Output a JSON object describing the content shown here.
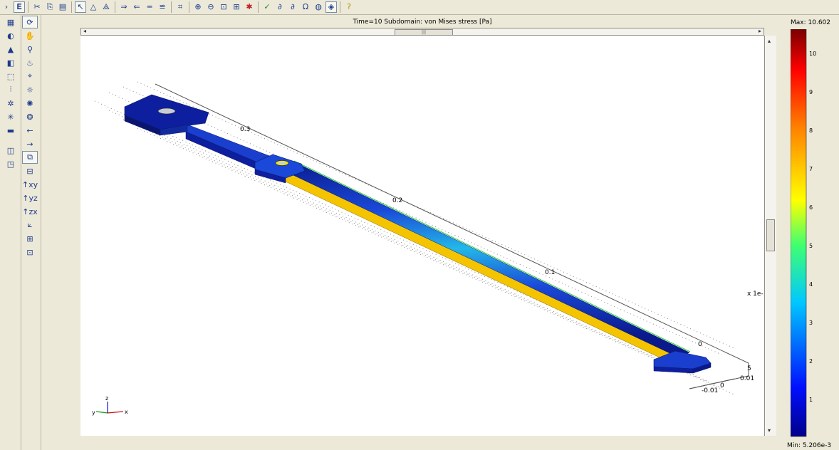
{
  "toolbar": {
    "icons": [
      "scissors-icon",
      "copy-icon",
      "paste-icon",
      "pointer-icon",
      "triangle-icon",
      "triangles-icon",
      "arrow-right-icon",
      "arrow-left-icon",
      "equals-icon",
      "stack-icon",
      "mesh-icon",
      "zoom-in-icon",
      "zoom-out-icon",
      "zoom-box-icon",
      "zoom-extents-icon",
      "plot-icon",
      "check-icon",
      "formula-icon",
      "formula2-icon",
      "omega-icon",
      "globe-icon",
      "render-icon",
      "help-icon"
    ],
    "glyphs": {
      "scissors": "✂",
      "copy": "⎘",
      "paste": "📋",
      "pointer": "↖",
      "triangle": "△",
      "triangles": "⟁",
      "arrow_right": "⇒",
      "arrow_left": "⇐",
      "equals": "═",
      "stack": "≌",
      "mesh": "⌗",
      "zoom_in": "⊕",
      "zoom_out": "⊖",
      "zoom_box": "⊡",
      "zoom_extents": "⊞",
      "plot": "✱",
      "check": "✓",
      "formula": "∂",
      "formula2": "∂",
      "omega": "Ω",
      "globe": "◍",
      "render": "◈",
      "help": "?"
    }
  },
  "plot": {
    "title": "Time=10    Subdomain: von Mises stress [Pa]",
    "axis_ticks": [
      "0.3",
      "0.2",
      "0.1",
      "0",
      "5",
      "0",
      "0.01",
      "-0.01"
    ],
    "scale_factor": "x 1e-",
    "triad": {
      "x": "x",
      "y": "y",
      "z": "z"
    }
  },
  "legend": {
    "max_label": "Max: 10.602",
    "min_label": "Min: 5.206e-3",
    "ticks": [
      "10",
      "9",
      "8",
      "7",
      "6",
      "5",
      "4",
      "3",
      "2",
      "1"
    ]
  },
  "colors": {
    "accent": "#1c3f8f",
    "dark_blue": "#0a1a8c",
    "yellow": "#f7c600"
  }
}
